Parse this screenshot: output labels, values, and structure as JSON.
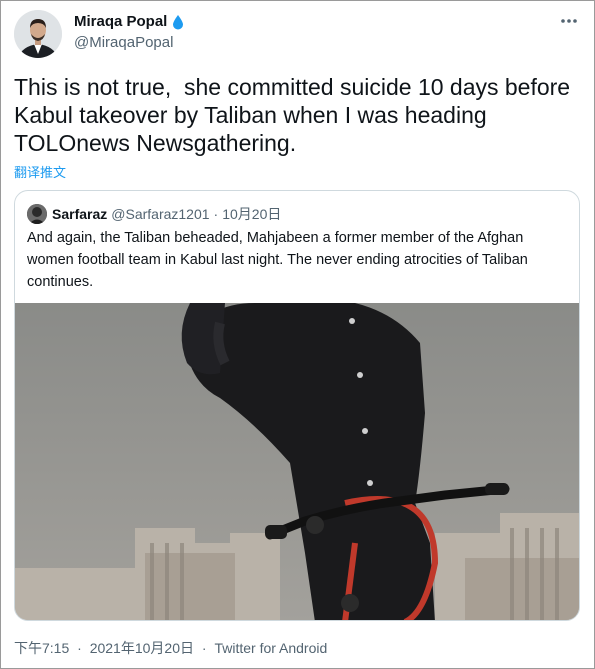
{
  "author": {
    "name": "Miraqa Popal",
    "handle": "@MiraqaPopal",
    "verified_icon": "water-drop-icon"
  },
  "tweet": {
    "text": "This is not true,  she committed suicide 10 days before Kabul takeover by Taliban when I was heading TOLOnews Newsgathering.",
    "translate_label": "翻译推文"
  },
  "quoted_tweet": {
    "name": "Sarfaraz",
    "handle": "@Sarfaraz1201",
    "separator": "·",
    "date": "10月20日",
    "text": "And again, the Taliban beheaded, Mahjabeen a former member of the Afghan women football team in Kabul last night. The never ending atrocities of Taliban continues."
  },
  "footer": {
    "time": "下午7:15",
    "separator": "·",
    "date": "2021年10月20日",
    "separator2": "·",
    "source": "Twitter for Android"
  },
  "colors": {
    "link": "#1d9bf0",
    "secondary_text": "#536471",
    "border": "#cfd9de",
    "verified": "#1d9bf0"
  }
}
